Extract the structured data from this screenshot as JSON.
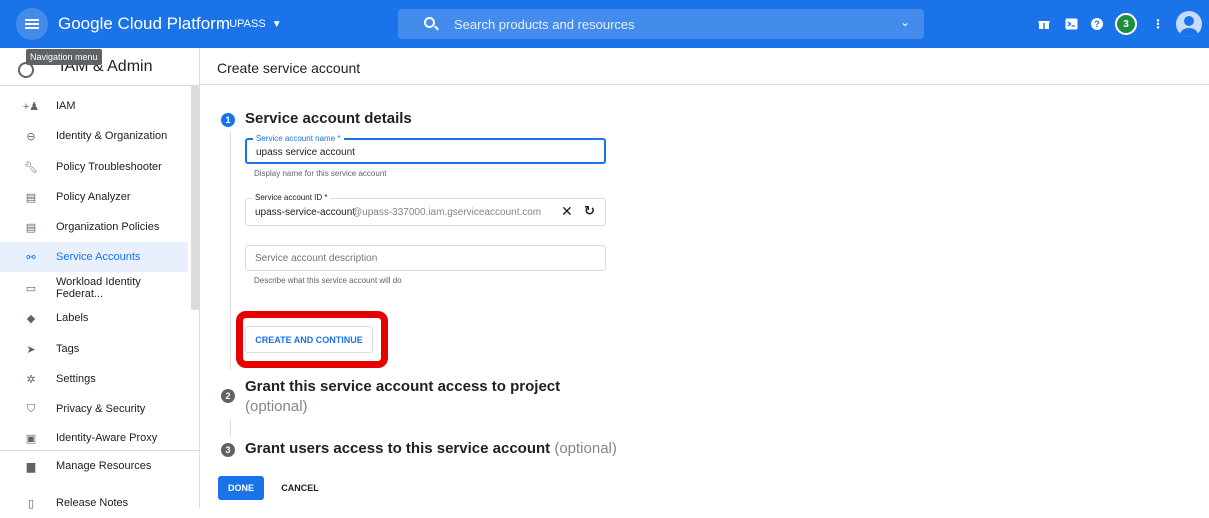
{
  "topbar": {
    "product_name": "Google Cloud Platform",
    "project_name": "UPASS",
    "search_placeholder": "Search products and resources",
    "notification_count": "3",
    "colors": {
      "bar": "#1a73e8",
      "badge": "#1e8e3e"
    }
  },
  "tooltip": "Navigation menu",
  "sidebar": {
    "title": "IAM & Admin",
    "items": [
      {
        "label": "IAM",
        "icon": "person-add-icon"
      },
      {
        "label": "Identity & Organization",
        "icon": "account-circle-icon"
      },
      {
        "label": "Policy Troubleshooter",
        "icon": "wrench-icon"
      },
      {
        "label": "Policy Analyzer",
        "icon": "document-search-icon"
      },
      {
        "label": "Organization Policies",
        "icon": "article-icon"
      },
      {
        "label": "Service Accounts",
        "icon": "service-account-icon",
        "active": true
      },
      {
        "label": "Workload Identity Federat...",
        "icon": "id-card-icon"
      },
      {
        "label": "Labels",
        "icon": "label-icon"
      },
      {
        "label": "Tags",
        "icon": "tag-icon"
      },
      {
        "label": "Settings",
        "icon": "gear-icon"
      },
      {
        "label": "Privacy & Security",
        "icon": "shield-icon"
      },
      {
        "label": "Identity-Aware Proxy",
        "icon": "proxy-icon"
      },
      {
        "label": "Manage Resources",
        "icon": "folder-icon"
      },
      {
        "label": "Release Notes",
        "icon": "notes-icon"
      }
    ]
  },
  "main": {
    "page_title": "Create service account",
    "step1": {
      "number": "1",
      "title": "Service account details",
      "name_field": {
        "label": "Service account name *",
        "value": "upass service account",
        "hint": "Display name for this service account"
      },
      "id_field": {
        "label": "Service account ID *",
        "value": "upass-service-account",
        "suffix": "@upass-337000.iam.gserviceaccount.com"
      },
      "description_field": {
        "placeholder": "Service account description",
        "hint": "Describe what this service account will do"
      },
      "create_button": "CREATE AND CONTINUE"
    },
    "step2": {
      "number": "2",
      "title": "Grant this service account access to project",
      "optional": "(optional)"
    },
    "step3": {
      "number": "3",
      "title": "Grant users access to this service account",
      "optional": "(optional)"
    },
    "done_button": "DONE",
    "cancel_button": "CANCEL"
  }
}
